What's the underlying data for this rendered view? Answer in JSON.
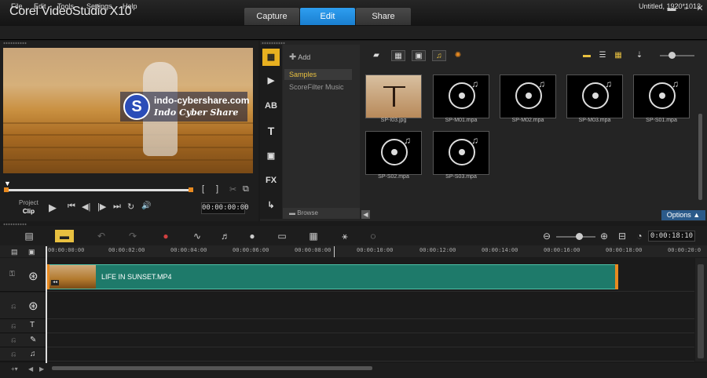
{
  "app": {
    "title": "Corel VideoStudio X10",
    "project_info": "Untitled, 1920*1012"
  },
  "tabs": [
    {
      "label": "Capture"
    },
    {
      "label": "Edit"
    },
    {
      "label": "Share"
    }
  ],
  "window": {
    "minimize": "▬",
    "restore": "▫",
    "close": "✕"
  },
  "menu": [
    {
      "label": "File"
    },
    {
      "label": "Edit"
    },
    {
      "label": "Tools"
    },
    {
      "label": "Settings"
    },
    {
      "label": "Help"
    }
  ],
  "player": {
    "watermark_url": "indo-cybershare.com",
    "watermark_name": "Indo Cyber Share",
    "watermark_logo": "S",
    "mark_in": "[",
    "mark_out": "]",
    "project_label": "Project",
    "clip_label": "Clip",
    "timecode": "00:00:00:00",
    "controls": {
      "play": "▶",
      "home": "⏮",
      "prev": "◀|",
      "next": "|▶",
      "end": "⏭",
      "repeat": "↻",
      "volume": "🔊",
      "split": "✂",
      "enlarge": "⧉"
    }
  },
  "library": {
    "add_label": "Add",
    "folders": [
      {
        "label": "Samples"
      },
      {
        "label": "ScoreFilter Music"
      }
    ],
    "browse_label": "Browse",
    "options_label": "Options ▲",
    "side_icons": [
      {
        "glyph": "▦"
      },
      {
        "glyph": "▶"
      },
      {
        "glyph": "AB"
      },
      {
        "glyph": "T"
      },
      {
        "glyph": "▣"
      },
      {
        "glyph": "FX"
      },
      {
        "glyph": "↳"
      }
    ],
    "items": [
      {
        "label": "SP-I03.jpg",
        "kind": "image"
      },
      {
        "label": "SP-M01.mpa",
        "kind": "audio"
      },
      {
        "label": "SP-M02.mpa",
        "kind": "audio"
      },
      {
        "label": "SP-M03.mpa",
        "kind": "audio"
      },
      {
        "label": "SP-S01.mpa",
        "kind": "audio"
      },
      {
        "label": "SP-S02.mpa",
        "kind": "audio"
      },
      {
        "label": "SP-S03.mpa",
        "kind": "audio"
      }
    ]
  },
  "timeline": {
    "timecode": "0:00:18:10",
    "ruler": [
      "00:00:00:00",
      "00:00:02:00",
      "00:00:04:00",
      "00:00:06:00",
      "00:00:08:00",
      "00:00:10:00",
      "00:00:12:00",
      "00:00:14:00",
      "00:00:16:00",
      "00:00:18:00",
      "00:00:20:0"
    ],
    "clip_title": "LIFE IN SUNSET.MP4"
  },
  "colors": {
    "accent": "#1a7fd0",
    "clip": "#1e7a6a",
    "selected_folder": "#e8c040"
  }
}
